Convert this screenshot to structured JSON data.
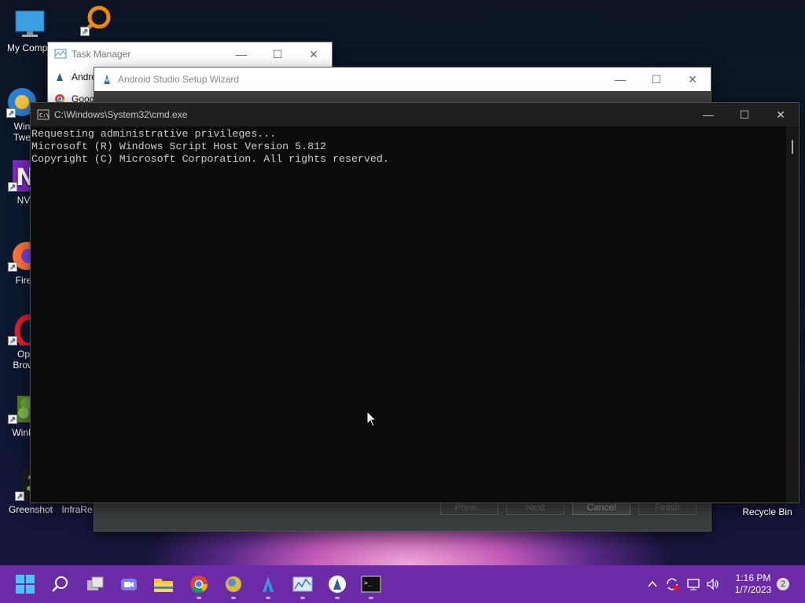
{
  "desktop": {
    "icons": [
      {
        "label": "My Compu",
        "icon": "monitor-icon"
      },
      {
        "label": "Win\nTwe",
        "icon": "browser-icon"
      },
      {
        "label": "NV",
        "icon": "nv-icon"
      },
      {
        "label": "Fire",
        "icon": "firefox-icon"
      },
      {
        "label": "Op\nBrow",
        "icon": "opera-icon"
      },
      {
        "label": "WinD",
        "icon": "windirstat-icon"
      },
      {
        "label": "Greenshot",
        "icon": "greenshot-icon"
      },
      {
        "label": "InfraRe",
        "icon": "infrarecorder-icon"
      }
    ],
    "recycle_bin_label": "Recycle Bin"
  },
  "task_manager": {
    "title": "Task Manager",
    "rows": [
      "Andro",
      "Goog"
    ]
  },
  "wizard": {
    "title": "Android Studio Setup Wizard",
    "buttons": {
      "prev": "Previ...",
      "next": "Next",
      "cancel": "Cancel",
      "finish": "Finish"
    }
  },
  "cmd": {
    "title": "C:\\Windows\\System32\\cmd.exe",
    "lines": [
      "Requesting administrative privileges...",
      "Microsoft (R) Windows Script Host Version 5.812",
      "Copyright (C) Microsoft Corporation. All rights reserved."
    ]
  },
  "taskbar": {
    "apps": [
      "start-icon",
      "search-icon",
      "task-view-icon",
      "chat-icon",
      "file-explorer-icon",
      "chrome-icon",
      "app-icon",
      "android-studio-icon",
      "task-manager-icon",
      "setup-wizard-icon",
      "cmd-icon"
    ],
    "clock_time": "1:16 PM",
    "clock_date": "1/7/2023",
    "notification_count": "2"
  },
  "colors": {
    "taskbar": "#6b2aa6",
    "cmd_bg": "#0c0c0c",
    "wizard_bg": "#3c3f41"
  }
}
